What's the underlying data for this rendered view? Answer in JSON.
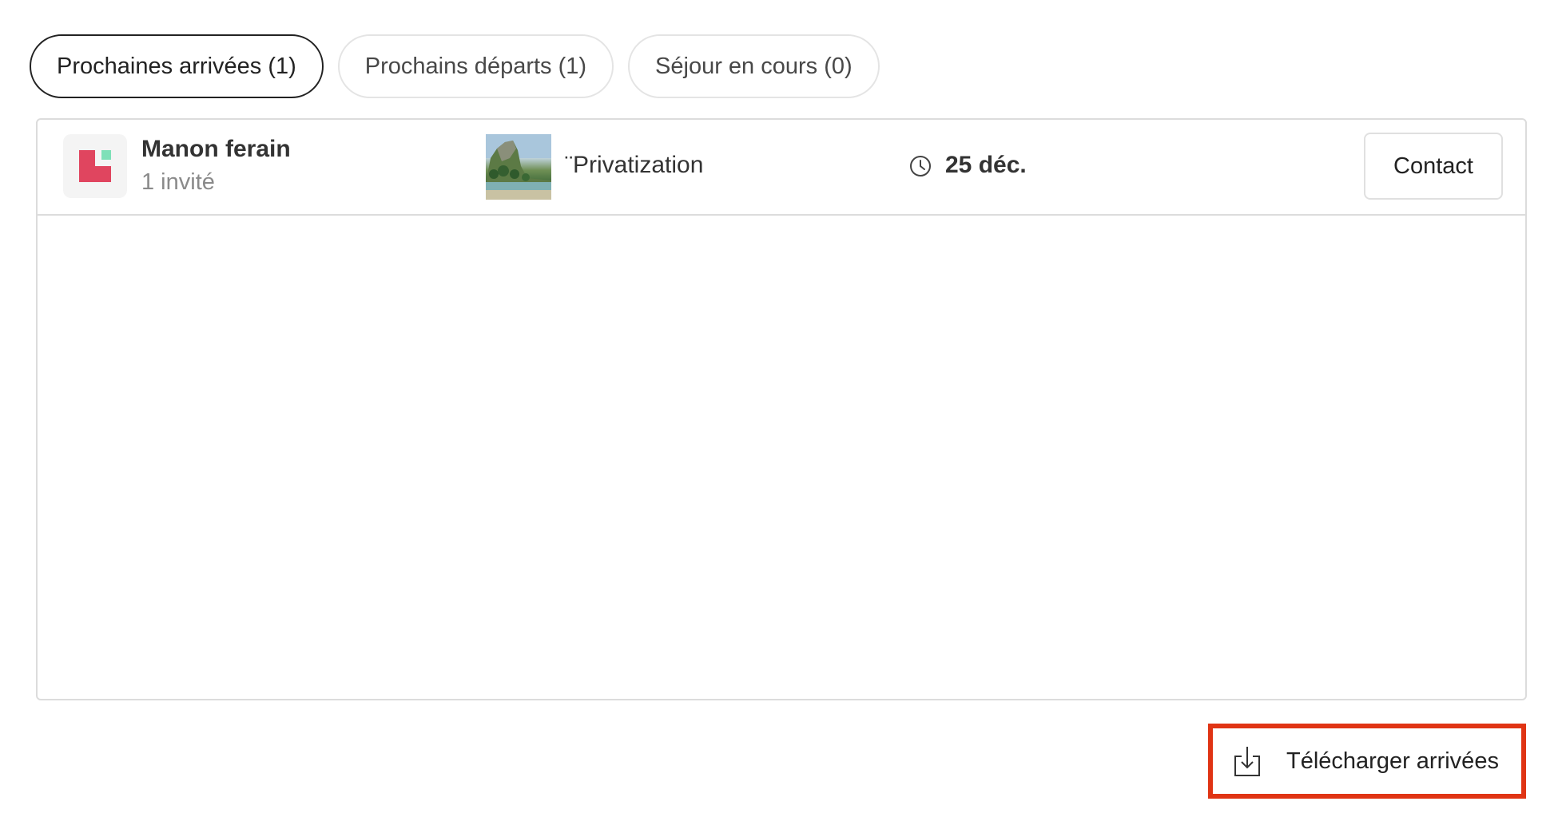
{
  "tabs": [
    {
      "label": "Prochaines arrivées (1)",
      "active": true
    },
    {
      "label": "Prochains départs (1)",
      "active": false
    },
    {
      "label": "Séjour en cours (0)",
      "active": false
    }
  ],
  "reservation": {
    "guest_name": "Manon ferain",
    "guest_count": "1 invité",
    "listing_name": "¨Privatization",
    "date": "25 déc.",
    "contact_label": "Contact",
    "avatar_icon": "host-logo-icon",
    "thumbnail_icon": "listing-photo",
    "date_icon": "clock-icon"
  },
  "download": {
    "label": "Télécharger arrivées",
    "icon": "download-icon",
    "highlight_color": "#e03414"
  }
}
